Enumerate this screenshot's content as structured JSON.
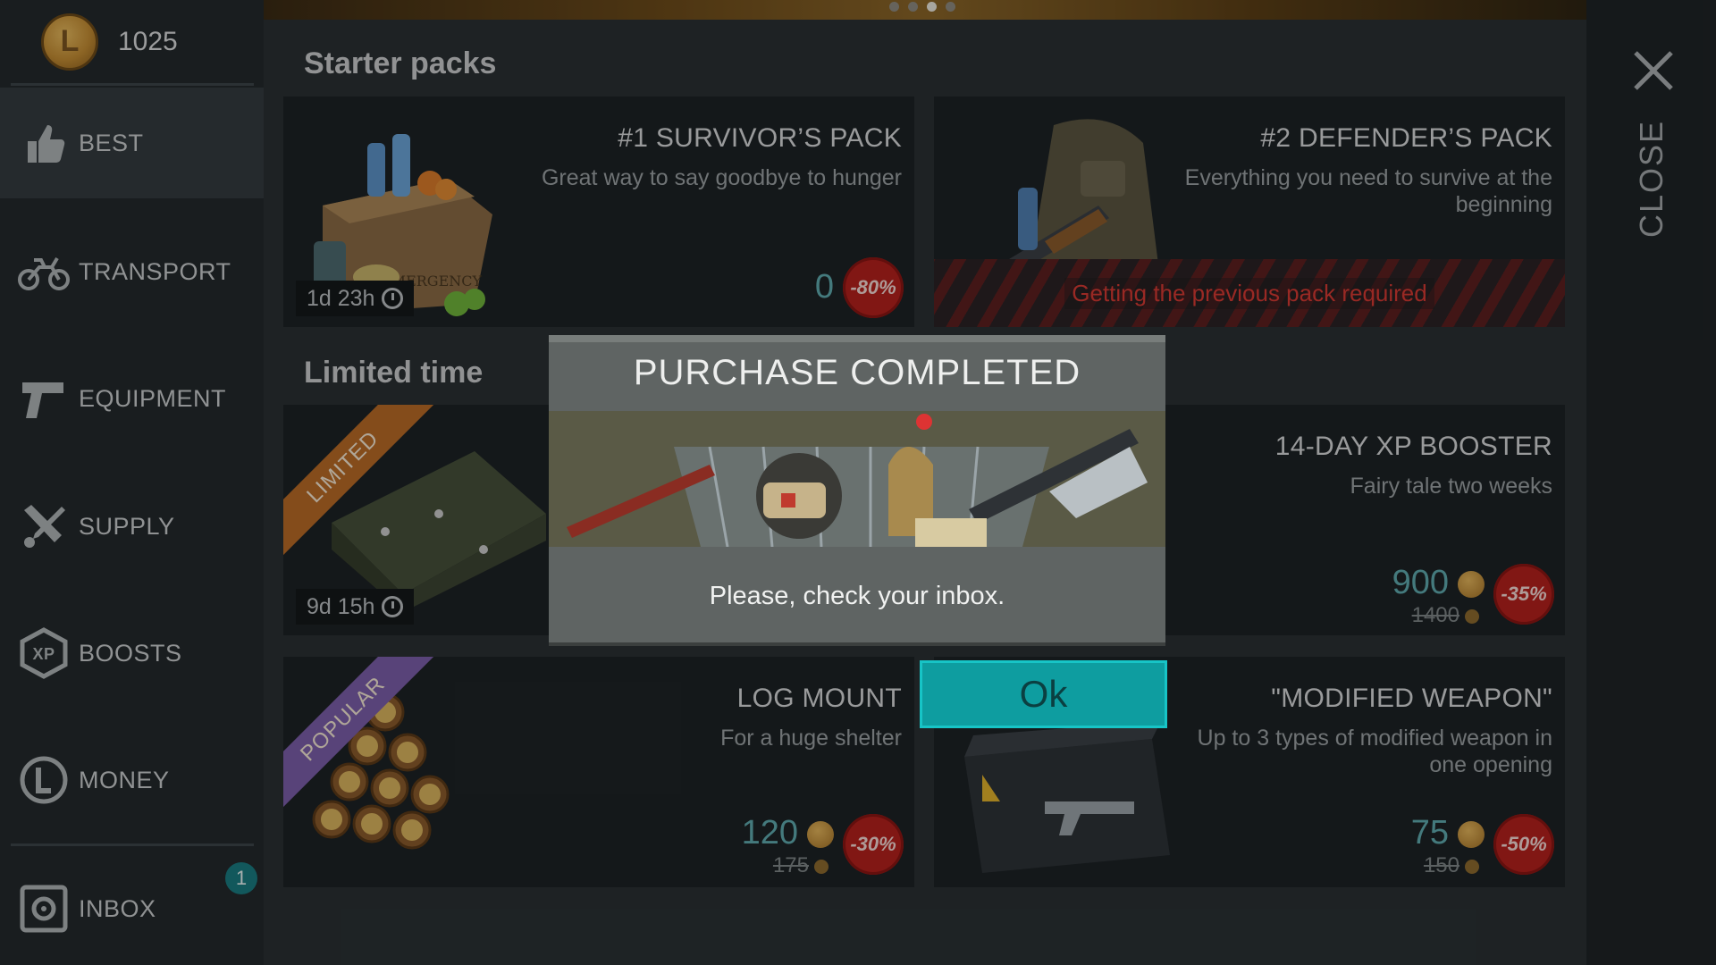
{
  "currency": {
    "amount": "1025",
    "icon": "coin-icon"
  },
  "sidebar": {
    "items": [
      {
        "label": "BEST",
        "icon": "thumbs-up-icon",
        "active": true
      },
      {
        "label": "TRANSPORT",
        "icon": "motorcycle-icon"
      },
      {
        "label": "EQUIPMENT",
        "icon": "pistol-icon"
      },
      {
        "label": "SUPPLY",
        "icon": "tools-icon"
      },
      {
        "label": "BOOSTS",
        "icon": "xp-badge-icon"
      },
      {
        "label": "MONEY",
        "icon": "coin-l-icon"
      },
      {
        "label": "INBOX",
        "icon": "safe-icon",
        "badge": "1"
      }
    ]
  },
  "sections": {
    "starter": "Starter packs",
    "limited": "Limited time"
  },
  "cards": {
    "survivor": {
      "title": "#1 SURVIVOR’S PACK",
      "desc": "Great way to say goodbye to hunger",
      "timer": "1d 23h",
      "price": "0",
      "sale": "-80%"
    },
    "defender": {
      "title": "#2 DEFENDER’S PACK",
      "desc": "Everything you need to survive at the beginning",
      "locked": "Getting the previous pack required"
    },
    "limited_box": {
      "ribbon": "LIMITED",
      "timer": "9d 15h"
    },
    "xp_booster": {
      "title": "14-DAY XP BOOSTER",
      "desc": "Fairy tale two weeks",
      "price": "900",
      "old_price": "1400",
      "sale": "-35%"
    },
    "log_mount": {
      "ribbon": "POPULAR",
      "title": "LOG MOUNT",
      "desc": "For a huge shelter",
      "price": "120",
      "old_price": "175",
      "sale": "-30%"
    },
    "modified_weapon": {
      "title": "\"MODIFIED WEAPON\"",
      "desc": "Up to 3 types of modified weapon in one opening",
      "price": "75",
      "old_price": "150",
      "sale": "-50%"
    }
  },
  "close": {
    "label": "CLOSE",
    "icon": "close-icon"
  },
  "modal": {
    "title": "PURCHASE COMPLETED",
    "message": "Please, check your inbox.",
    "ok_label": "Ok"
  },
  "colors": {
    "accent": "#0e9da0",
    "sale": "#b3201d",
    "price": "#5fa9ad",
    "locked": "#d43a33"
  }
}
